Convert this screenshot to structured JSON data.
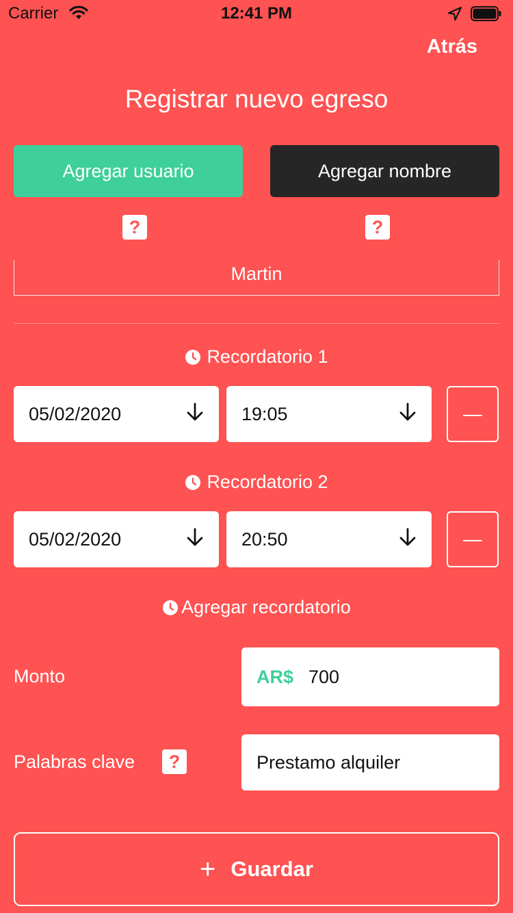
{
  "status_bar": {
    "carrier": "Carrier",
    "time": "12:41 PM"
  },
  "header": {
    "back_label": "Atrás",
    "title": "Registrar nuevo egreso"
  },
  "mode_buttons": {
    "add_user": "Agregar usuario",
    "add_name": "Agregar nombre"
  },
  "help_glyph": "?",
  "name_field": {
    "value": "Martin"
  },
  "reminders": [
    {
      "title": "Recordatorio 1",
      "date": "05/02/2020",
      "time": "19:05"
    },
    {
      "title": "Recordatorio 2",
      "date": "05/02/2020",
      "time": "20:50"
    }
  ],
  "reminder_remove_glyph": "—",
  "add_reminder_label": "Agregar recordatorio",
  "amount": {
    "label": "Monto",
    "currency": "AR$",
    "value": "700"
  },
  "keywords": {
    "label": "Palabras clave",
    "value": "Prestamo alquiler"
  },
  "save": {
    "icon": "+",
    "label": "Guardar"
  },
  "colors": {
    "background": "#ff5252",
    "accent_green": "#3ecf9a",
    "dark_button": "#262626"
  }
}
